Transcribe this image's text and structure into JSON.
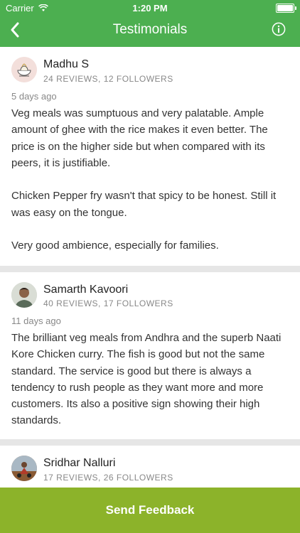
{
  "status_bar": {
    "carrier": "Carrier",
    "time": "1:20 PM"
  },
  "header": {
    "title": "Testimonials"
  },
  "reviews": [
    {
      "name": "Madhu S",
      "stats": "24 REVIEWS, 12 FOLLOWERS",
      "ago": "5 days ago",
      "body": "Veg meals was sumptuous and very palatable. Ample amount of ghee with the rice makes it even better. The price is on the higher side but when compared with its peers, it is justifiable.\n\nChicken Pepper fry wasn't that spicy to be honest. Still it was easy on the tongue.\n\nVery good ambience, especially for families."
    },
    {
      "name": "Samarth Kavoori",
      "stats": "40 REVIEWS, 17 FOLLOWERS",
      "ago": "11 days ago",
      "body": "The brilliant veg meals from Andhra and the superb Naati Kore Chicken curry. The fish is good but not the same standard. The service is good but there is always a tendency to rush people as they want more and more customers. Its also a positive sign showing their high standards."
    },
    {
      "name": "Sridhar Nalluri",
      "stats": "17 REVIEWS, 26 FOLLOWERS"
    }
  ],
  "footer": {
    "send_feedback": "Send Feedback"
  }
}
